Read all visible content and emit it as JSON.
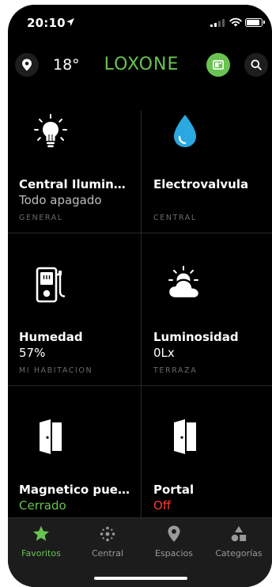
{
  "status_bar": {
    "time": "20:10"
  },
  "header": {
    "temperature": "18°",
    "brand": "LOXONE",
    "accent_color": "#69C350"
  },
  "tiles": [
    {
      "title": "Central Ilumin…",
      "status": "Todo apagado",
      "room": "GENERAL",
      "icon": "lightbulb-icon",
      "status_color": "#bdbdbd"
    },
    {
      "title": "Electrovalvula",
      "status": "",
      "room": "CENTRAL",
      "icon": "water-drop-icon",
      "status_color": "#bdbdbd"
    },
    {
      "title": "Humedad",
      "status": "57%",
      "room": "MI HABITACION",
      "icon": "humidity-sensor-icon",
      "status_color": "#ffffff"
    },
    {
      "title": "Luminosidad",
      "status": "0Lx",
      "room": "TERRAZA",
      "icon": "sun-cloud-icon",
      "status_color": "#ffffff"
    },
    {
      "title": "Magnetico pue…",
      "status": "Cerrado",
      "room": "",
      "icon": "door-icon",
      "status_color": "#69C350"
    },
    {
      "title": "Portal",
      "status": "Off",
      "room": "",
      "icon": "door-icon",
      "status_color": "#ff3b30"
    }
  ],
  "tabbar": {
    "items": [
      {
        "label": "Favoritos",
        "icon": "star-icon",
        "active": true
      },
      {
        "label": "Central",
        "icon": "dots-grid-icon",
        "active": false
      },
      {
        "label": "Espacios",
        "icon": "location-pin-icon",
        "active": false
      },
      {
        "label": "Categorías",
        "icon": "shapes-icon",
        "active": false
      }
    ]
  }
}
